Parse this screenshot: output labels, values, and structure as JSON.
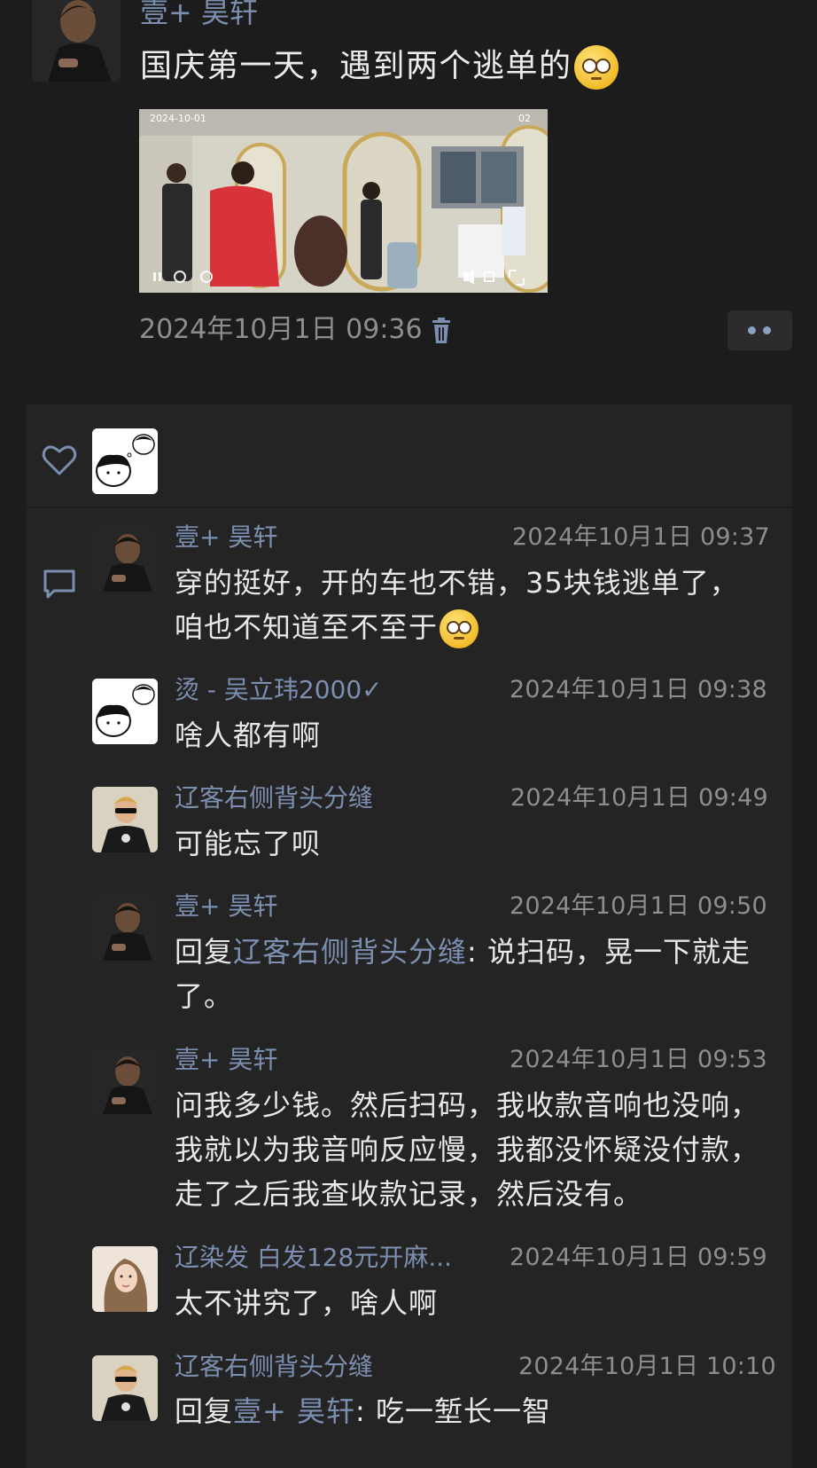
{
  "post": {
    "author": "壹+ 昊轩",
    "text": "国庆第一天，遇到两个逃单的",
    "timestamp": "2024年10月1日 09:36",
    "video": {
      "overlay_date": "2024-10-01",
      "overlay_corner": "02"
    },
    "icons": {
      "delete": "trash-icon",
      "more": "more-dots-icon",
      "emoji": "pleading-face-emoji"
    }
  },
  "likes": {
    "icon": "heart-icon"
  },
  "comments_icon": "comment-icon",
  "comments": [
    {
      "name": "壹+ 昊轩",
      "time": "2024年10月1日 09:37",
      "text": "穿的挺好，开的车也不错，35块钱逃单了，咱也不知道至不至于",
      "avatar": "man-portrait"
    },
    {
      "name": "烫 - 吴立玮2000✓",
      "time": "2024年10月1日 09:38",
      "text": "啥人都有啊",
      "avatar": "cartoon-boy"
    },
    {
      "name": "辽客右侧背头分缝",
      "time": "2024年10月1日 09:49",
      "text": "可能忘了呗",
      "avatar": "man-sunglasses"
    },
    {
      "name": "壹+ 昊轩",
      "time": "2024年10月1日 09:50",
      "reply_prefix": "回复",
      "reply_to": "辽客右侧背头分缝",
      "reply_sep": ": ",
      "text": "说扫码，晃一下就走了。",
      "avatar": "man-portrait"
    },
    {
      "name": "壹+ 昊轩",
      "time": "2024年10月1日 09:53",
      "text": "问我多少钱。然后扫码，我收款音响也没响，我就以为我音响反应慢，我都没怀疑没付款，走了之后我查收款记录，然后没有。",
      "avatar": "man-portrait"
    },
    {
      "name": "辽染发 白发128元开麻...",
      "time": "2024年10月1日 09:59",
      "text": "太不讲究了，啥人啊",
      "avatar": "woman-portrait"
    },
    {
      "name": "辽客右侧背头分缝",
      "time": "2024年10月1日 10:10",
      "reply_prefix": "回复",
      "reply_to": "壹+ 昊轩",
      "reply_sep": ": ",
      "text": "吃一堑长一智",
      "avatar": "man-sunglasses"
    }
  ]
}
